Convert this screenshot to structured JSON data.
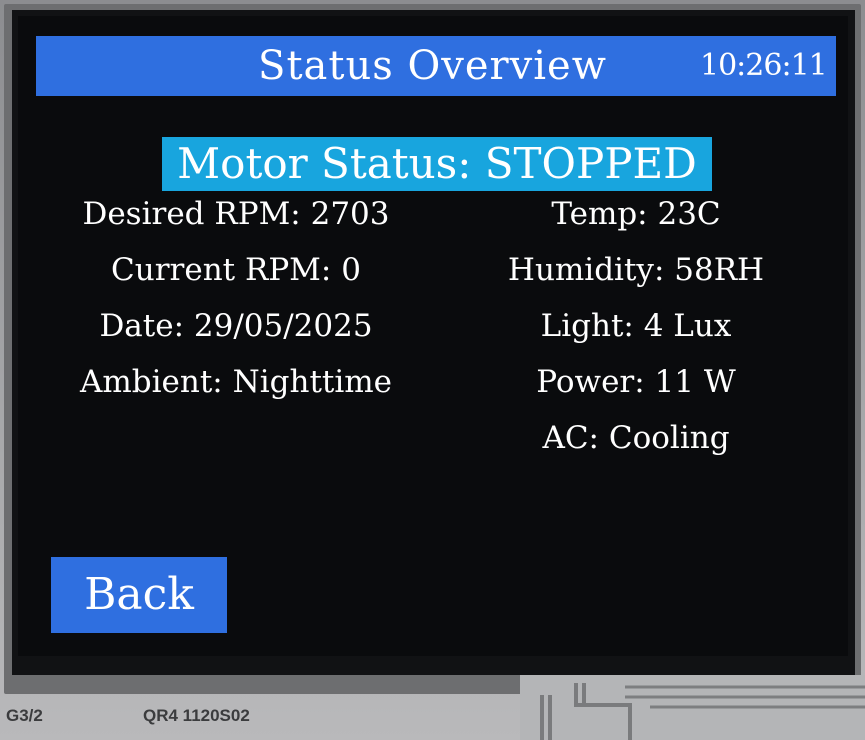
{
  "header": {
    "title": "Status Overview",
    "time": "10:26:11"
  },
  "motor": {
    "status_label": "Motor Status: STOPPED"
  },
  "left_fields": [
    {
      "label": "Desired RPM: 2703"
    },
    {
      "label": "Current RPM: 0"
    },
    {
      "label": "Date: 29/05/2025"
    },
    {
      "label": "Ambient: Nighttime"
    }
  ],
  "right_fields": [
    {
      "label": "Temp: 23C"
    },
    {
      "label": "Humidity: 58RH"
    },
    {
      "label": "Light: 4 Lux"
    },
    {
      "label": "Power: 11 W"
    },
    {
      "label": "AC: Cooling"
    }
  ],
  "back_button": {
    "label": "Back"
  },
  "hardware": {
    "print_left": "G3/2",
    "print_right": "QR4  1120S02"
  },
  "colors": {
    "title_bar": "#2f6fe0",
    "motor_banner": "#18a5de",
    "screen_bg": "#0a0b0d",
    "text": "#ffffff"
  }
}
